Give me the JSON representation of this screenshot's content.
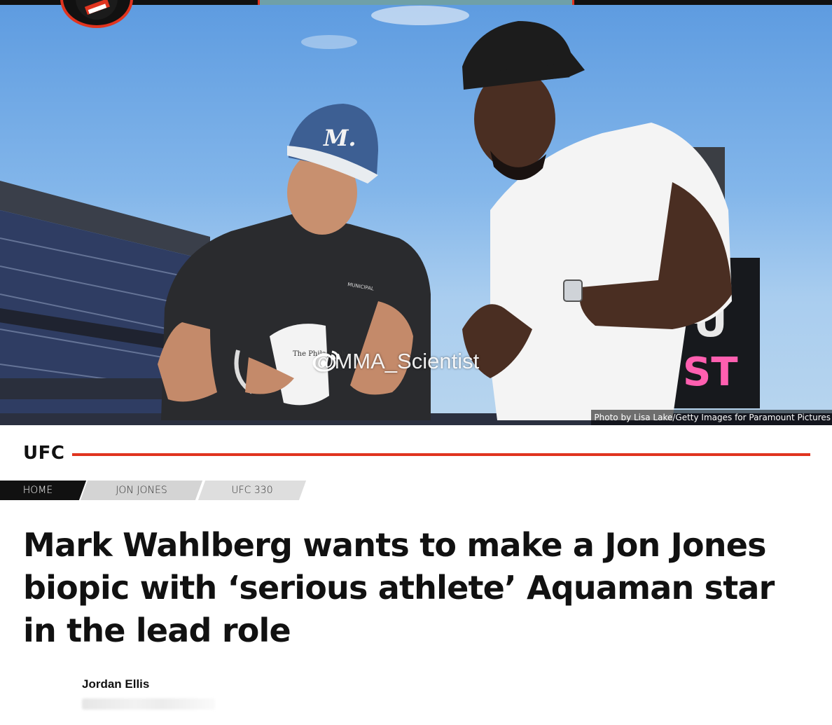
{
  "hero": {
    "watermark": "@MMA_Scientist",
    "photo_credit": "Photo by Lisa Lake/Getty Images for Paramount Pictures",
    "cap_left_text": "M.",
    "shirt_text": "MUNICIPAL",
    "mug_text": "The Philadelphia"
  },
  "section": {
    "label": "UFC",
    "accent_color": "#e0341f"
  },
  "breadcrumbs": [
    {
      "label": "HOME"
    },
    {
      "label": "JON JONES"
    },
    {
      "label": "UFC 330"
    }
  ],
  "article": {
    "headline": "Mark Wahlberg wants to make a Jon Jones biopic with ‘serious athlete’ Aquaman star in the lead role",
    "author": "Jordan Ellis"
  },
  "icons": {
    "logo": "site-logo-icon",
    "watermark": "weibo-icon"
  }
}
